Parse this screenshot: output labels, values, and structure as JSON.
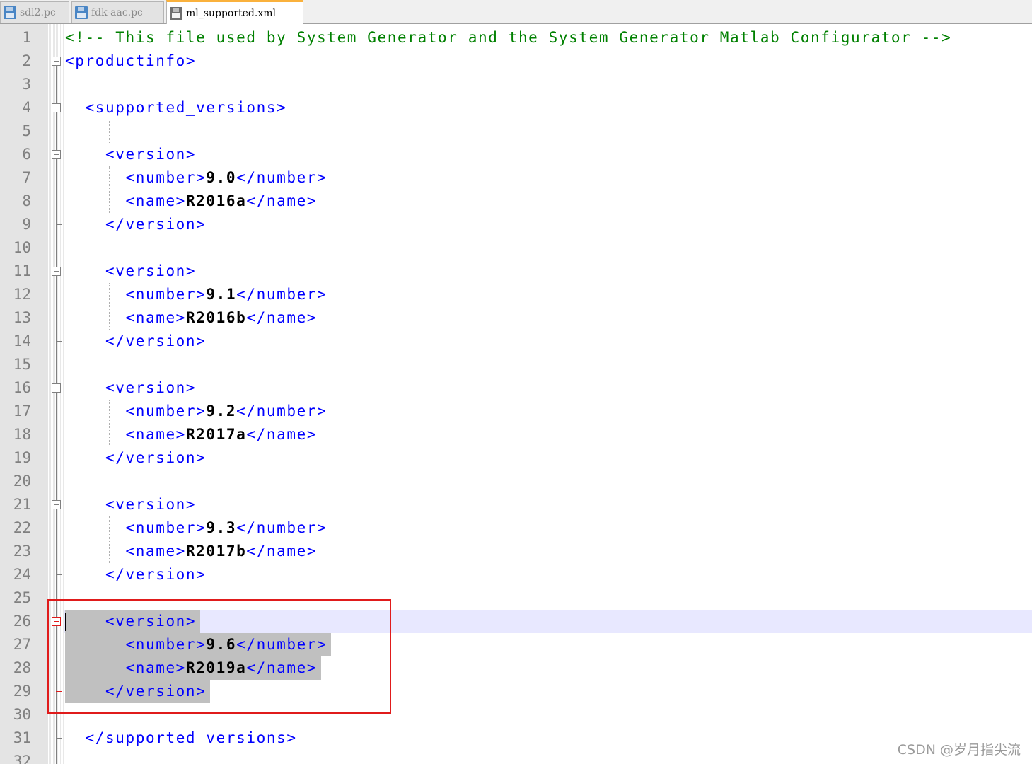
{
  "tabs": [
    {
      "label": "sdl2.pc",
      "active": false
    },
    {
      "label": "fdk-aac.pc",
      "active": false
    },
    {
      "label": "ml_supported.xml",
      "active": true
    }
  ],
  "lines": [
    {
      "n": "1",
      "indent": 0,
      "parts": [
        {
          "t": "<!-- This file used by System Generator and the System Generator Matlab Configurator -->",
          "c": "comment"
        }
      ]
    },
    {
      "n": "2",
      "indent": 0,
      "fold": "open",
      "parts": [
        {
          "t": "<productinfo>",
          "c": "tag"
        }
      ]
    },
    {
      "n": "3",
      "indent": 0,
      "parts": []
    },
    {
      "n": "4",
      "indent": 1,
      "fold": "open",
      "parts": [
        {
          "t": "<supported_versions>",
          "c": "tag"
        }
      ]
    },
    {
      "n": "5",
      "indent": 0,
      "parts": []
    },
    {
      "n": "6",
      "indent": 2,
      "fold": "open",
      "parts": [
        {
          "t": "<version>",
          "c": "tag"
        }
      ]
    },
    {
      "n": "7",
      "indent": 3,
      "parts": [
        {
          "t": "<number>",
          "c": "tag"
        },
        {
          "t": "9.0",
          "c": "text"
        },
        {
          "t": "</number>",
          "c": "tag"
        }
      ]
    },
    {
      "n": "8",
      "indent": 3,
      "parts": [
        {
          "t": "<name>",
          "c": "tag"
        },
        {
          "t": "R2016a",
          "c": "text"
        },
        {
          "t": "</name>",
          "c": "tag"
        }
      ]
    },
    {
      "n": "9",
      "indent": 2,
      "fold": "end",
      "parts": [
        {
          "t": "</version>",
          "c": "tag"
        }
      ]
    },
    {
      "n": "10",
      "indent": 0,
      "parts": []
    },
    {
      "n": "11",
      "indent": 2,
      "fold": "open",
      "parts": [
        {
          "t": "<version>",
          "c": "tag"
        }
      ]
    },
    {
      "n": "12",
      "indent": 3,
      "parts": [
        {
          "t": "<number>",
          "c": "tag"
        },
        {
          "t": "9.1",
          "c": "text"
        },
        {
          "t": "</number>",
          "c": "tag"
        }
      ]
    },
    {
      "n": "13",
      "indent": 3,
      "parts": [
        {
          "t": "<name>",
          "c": "tag"
        },
        {
          "t": "R2016b",
          "c": "text"
        },
        {
          "t": "</name>",
          "c": "tag"
        }
      ]
    },
    {
      "n": "14",
      "indent": 2,
      "fold": "end",
      "parts": [
        {
          "t": "</version>",
          "c": "tag"
        }
      ]
    },
    {
      "n": "15",
      "indent": 0,
      "parts": []
    },
    {
      "n": "16",
      "indent": 2,
      "fold": "open",
      "parts": [
        {
          "t": "<version>",
          "c": "tag"
        }
      ]
    },
    {
      "n": "17",
      "indent": 3,
      "parts": [
        {
          "t": "<number>",
          "c": "tag"
        },
        {
          "t": "9.2",
          "c": "text"
        },
        {
          "t": "</number>",
          "c": "tag"
        }
      ]
    },
    {
      "n": "18",
      "indent": 3,
      "parts": [
        {
          "t": "<name>",
          "c": "tag"
        },
        {
          "t": "R2017a",
          "c": "text"
        },
        {
          "t": "</name>",
          "c": "tag"
        }
      ]
    },
    {
      "n": "19",
      "indent": 2,
      "fold": "end",
      "parts": [
        {
          "t": "</version>",
          "c": "tag"
        }
      ]
    },
    {
      "n": "20",
      "indent": 0,
      "parts": []
    },
    {
      "n": "21",
      "indent": 2,
      "fold": "open",
      "parts": [
        {
          "t": "<version>",
          "c": "tag"
        }
      ]
    },
    {
      "n": "22",
      "indent": 3,
      "parts": [
        {
          "t": "<number>",
          "c": "tag"
        },
        {
          "t": "9.3",
          "c": "text"
        },
        {
          "t": "</number>",
          "c": "tag"
        }
      ]
    },
    {
      "n": "23",
      "indent": 3,
      "parts": [
        {
          "t": "<name>",
          "c": "tag"
        },
        {
          "t": "R2017b",
          "c": "text"
        },
        {
          "t": "</name>",
          "c": "tag"
        }
      ]
    },
    {
      "n": "24",
      "indent": 2,
      "fold": "end",
      "parts": [
        {
          "t": "</version>",
          "c": "tag"
        }
      ]
    },
    {
      "n": "25",
      "indent": 0,
      "parts": []
    },
    {
      "n": "26",
      "indent": 2,
      "fold": "open",
      "selected": true,
      "current": true,
      "parts": [
        {
          "t": "<version>",
          "c": "tag"
        }
      ]
    },
    {
      "n": "27",
      "indent": 3,
      "selected": true,
      "parts": [
        {
          "t": "<number>",
          "c": "tag"
        },
        {
          "t": "9.6",
          "c": "text"
        },
        {
          "t": "</number>",
          "c": "tag"
        }
      ]
    },
    {
      "n": "28",
      "indent": 3,
      "selected": true,
      "parts": [
        {
          "t": "<name>",
          "c": "tag"
        },
        {
          "t": "R2019a",
          "c": "text"
        },
        {
          "t": "</name>",
          "c": "tag"
        }
      ]
    },
    {
      "n": "29",
      "indent": 2,
      "fold": "end",
      "selected": true,
      "parts": [
        {
          "t": "</version>",
          "c": "tag"
        }
      ]
    },
    {
      "n": "30",
      "indent": 0,
      "parts": []
    },
    {
      "n": "31",
      "indent": 1,
      "fold": "end",
      "parts": [
        {
          "t": "</supported_versions>",
          "c": "tag"
        }
      ]
    },
    {
      "n": "32",
      "indent": 0,
      "parts": []
    }
  ],
  "colors": {
    "comment": "#008000",
    "tag": "#0000ff",
    "text": "#000000",
    "highlight_box": "#e01b1b",
    "selection": "#c0c0c0",
    "current_line": "#e8e8ff"
  },
  "watermark": "CSDN @岁月指尖流"
}
